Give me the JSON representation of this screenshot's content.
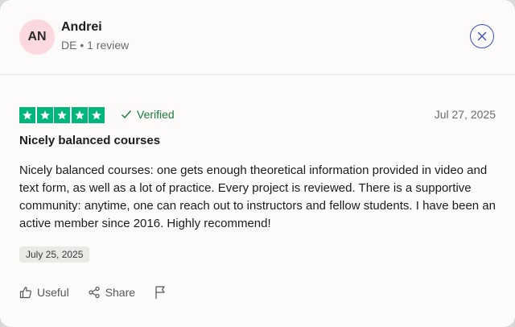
{
  "reviewer": {
    "initials": "AN",
    "name": "Andrei",
    "meta": "DE • 1 review"
  },
  "review": {
    "rating": 5,
    "verified_label": "Verified",
    "date": "Jul 27, 2025",
    "title": "Nicely balanced courses",
    "body": "Nicely balanced courses: one gets enough theoretical information provided in video and text form, as well as a lot of practice. Every project is reviewed. There is a supportive community: anytime, one can reach out to instructors and fellow students. I have been an active member since 2016. Highly recommend!",
    "experience_date": "July 25, 2025"
  },
  "actions": {
    "useful_label": "Useful",
    "share_label": "Share"
  },
  "colors": {
    "star_green": "#00b67a",
    "verified_green": "#1a7a3a",
    "close_blue": "#3b4cc0",
    "avatar_pink": "#fcd9e0"
  },
  "icons": [
    "close-icon",
    "star-icon",
    "check-icon",
    "thumbs-up-icon",
    "share-icon",
    "flag-icon"
  ]
}
